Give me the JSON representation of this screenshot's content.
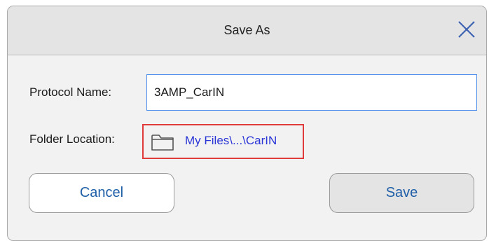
{
  "dialog": {
    "title": "Save As",
    "close_icon": "close-icon"
  },
  "protocol_name": {
    "label": "Protocol Name:",
    "value": "3AMP_CarIN"
  },
  "folder_location": {
    "label": "Folder Location:",
    "icon": "folder-icon",
    "path": "My Files\\...\\CarIN"
  },
  "buttons": {
    "cancel_label": "Cancel",
    "save_label": "Save"
  },
  "colors": {
    "link_text": "#2a35d6",
    "highlight_border": "#e03a3a",
    "input_focus_border": "#4d8fe8",
    "button_text": "#1f5fa8"
  }
}
